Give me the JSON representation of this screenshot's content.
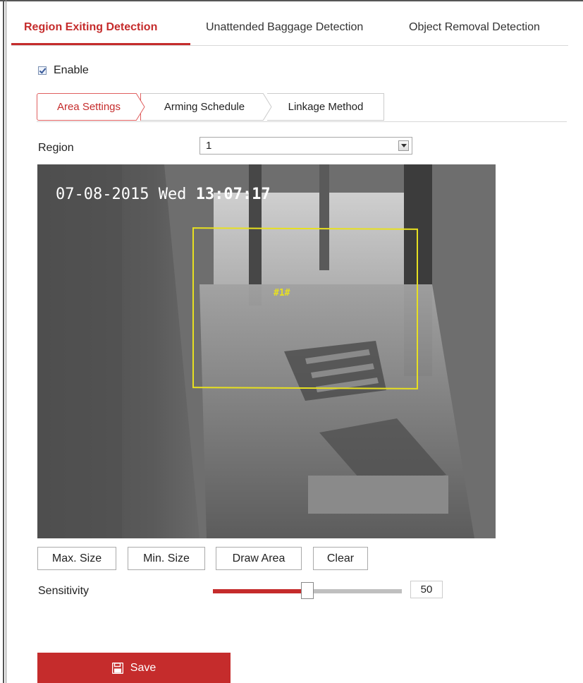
{
  "top_tabs": [
    {
      "label": "Region Exiting Detection",
      "active": true
    },
    {
      "label": "Unattended Baggage Detection",
      "active": false
    },
    {
      "label": "Object Removal Detection",
      "active": false
    }
  ],
  "enable": {
    "label": "Enable",
    "checked": true
  },
  "sub_tabs": [
    {
      "label": "Area Settings",
      "active": true
    },
    {
      "label": "Arming Schedule",
      "active": false
    },
    {
      "label": "Linkage Method",
      "active": false
    }
  ],
  "region": {
    "label": "Region",
    "value": "1"
  },
  "video": {
    "osd_date": "07-08-2015 Wed",
    "osd_time": "13:07:17",
    "area_label": "#1#"
  },
  "buttons": {
    "max_size": "Max. Size",
    "min_size": "Min. Size",
    "draw_area": "Draw Area",
    "clear": "Clear"
  },
  "sensitivity": {
    "label": "Sensitivity",
    "value": "50",
    "level": 50
  },
  "save": {
    "label": "Save"
  },
  "colors": {
    "accent": "#c52c2c",
    "detection_box": "#e7e020",
    "slider_track": "#bfbfbf"
  }
}
